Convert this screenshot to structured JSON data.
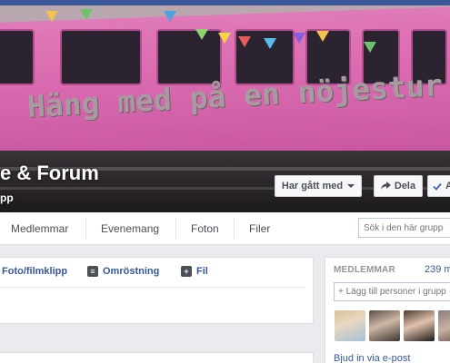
{
  "group": {
    "title": "e & Forum",
    "subtitle": "pp",
    "cover_slogan": "Häng med på en nöjestur och retur"
  },
  "actions": {
    "joined_label": "Har gått med",
    "share_label": "Dela",
    "notify_label": "A"
  },
  "nav": {
    "items": [
      {
        "label": "Medlemmar"
      },
      {
        "label": "Evenemang"
      },
      {
        "label": "Foton"
      },
      {
        "label": "Filer"
      }
    ],
    "search_placeholder": "Sök i den här grupp"
  },
  "composer": {
    "options": [
      {
        "label": "Foto/filmklipp",
        "icon": "photo-icon"
      },
      {
        "label": "Omröstning",
        "icon": "poll-icon"
      },
      {
        "label": "Fil",
        "icon": "file-icon"
      }
    ]
  },
  "members": {
    "heading": "MEDLEMMAR",
    "count": "239 m",
    "add_placeholder": "+ Lägg till personer i grupp",
    "invite_label": "Bjud in via e-post"
  },
  "colors": {
    "brand": "#3b5998",
    "link": "#365899",
    "cover_pink": "#d868ae"
  }
}
